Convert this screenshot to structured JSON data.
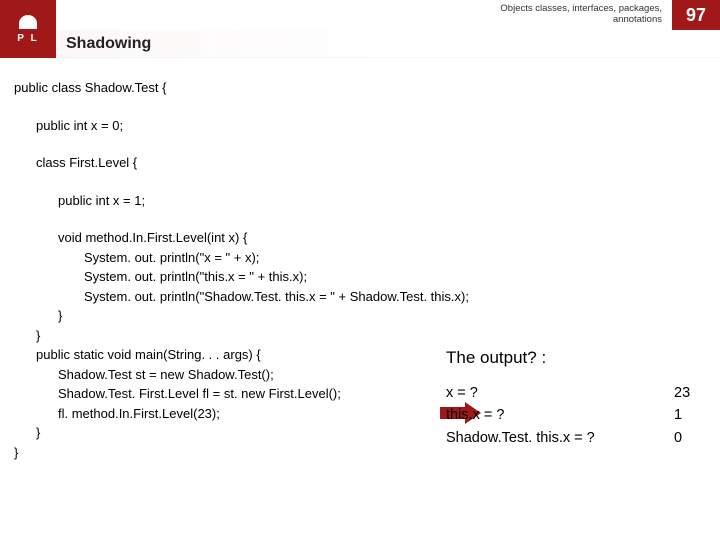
{
  "header": {
    "breadcrumb_line1": "Objects classes, interfaces, packages,",
    "breadcrumb_line2": "annotations",
    "page_number": "97",
    "logo_letters": "P   L",
    "title": "Shadowing"
  },
  "code": {
    "l1": "public class Shadow.Test {",
    "l2": "public int x = 0;",
    "l3": "class First.Level {",
    "l4": "public int x = 1;",
    "l5": "void method.In.First.Level(int x) {",
    "l6": "System. out. println(\"x = \" + x);",
    "l7": "System. out. println(\"this.x = \" + this.x);",
    "l8": "System. out. println(\"Shadow.Test. this.x = \" + Shadow.Test. this.x);",
    "l9": "}",
    "l10": "}",
    "l11": "public static void main(String. . . args) {",
    "l12": "Shadow.Test st = new Shadow.Test();",
    "l13": "Shadow.Test. First.Level fl = st. new First.Level();",
    "l14": "fl. method.In.First.Level(23);",
    "l15": "}",
    "l16": "}"
  },
  "output": {
    "title": "The output? :",
    "rows": [
      {
        "q": "x = ?",
        "a": "23"
      },
      {
        "q": "this.x = ?",
        "a": "1"
      },
      {
        "q": "Shadow.Test. this.x = ?",
        "a": "0"
      }
    ]
  }
}
